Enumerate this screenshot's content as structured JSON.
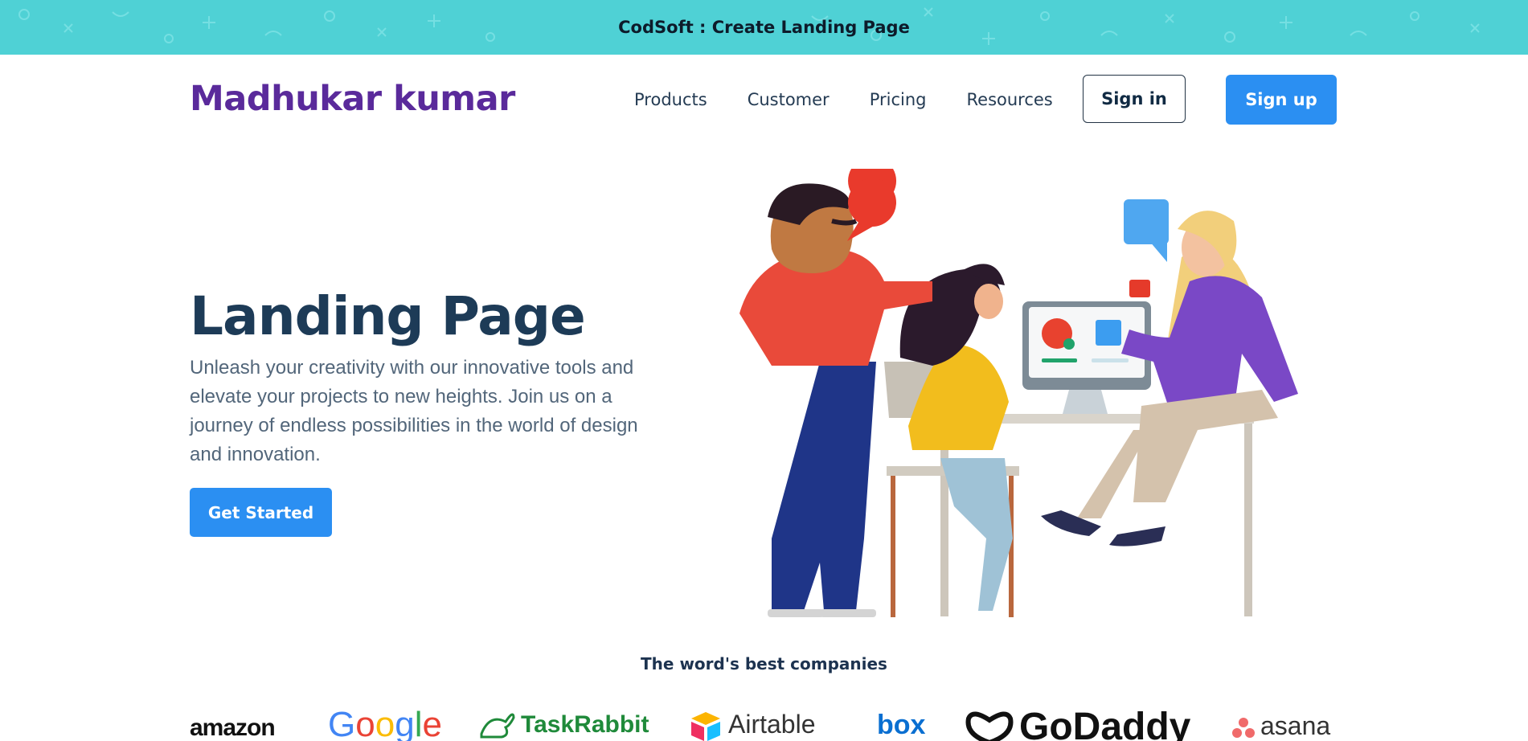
{
  "topbar": {
    "title": "CodSoft : Create Landing Page",
    "background": "#4fd1d5"
  },
  "navbar": {
    "brand": "Madhukar kumar",
    "links": [
      "Products",
      "Customer",
      "Pricing",
      "Resources"
    ],
    "signin_label": "Sign in",
    "signup_label": "Sign up"
  },
  "hero": {
    "title": "Landing Page",
    "description": "Unleash your creativity with our innovative tools and elevate your projects to new heights. Join us on a journey of endless possibilities in the world of design and innovation.",
    "cta_label": "Get Started"
  },
  "companies": {
    "title": "The word's best companies",
    "logos": [
      "amazon",
      "Google",
      "TaskRabbit",
      "Airtable",
      "box",
      "GoDaddy",
      "asana"
    ]
  },
  "colors": {
    "brand": "#5a2a9b",
    "primary_button": "#2b8ff2",
    "heading": "#1d3b57"
  },
  "icons": {
    "taskrabbit": "rabbit-icon",
    "airtable": "airtable-cube-icon",
    "godaddy": "godaddy-mark-icon",
    "asana": "asana-dots-icon"
  }
}
